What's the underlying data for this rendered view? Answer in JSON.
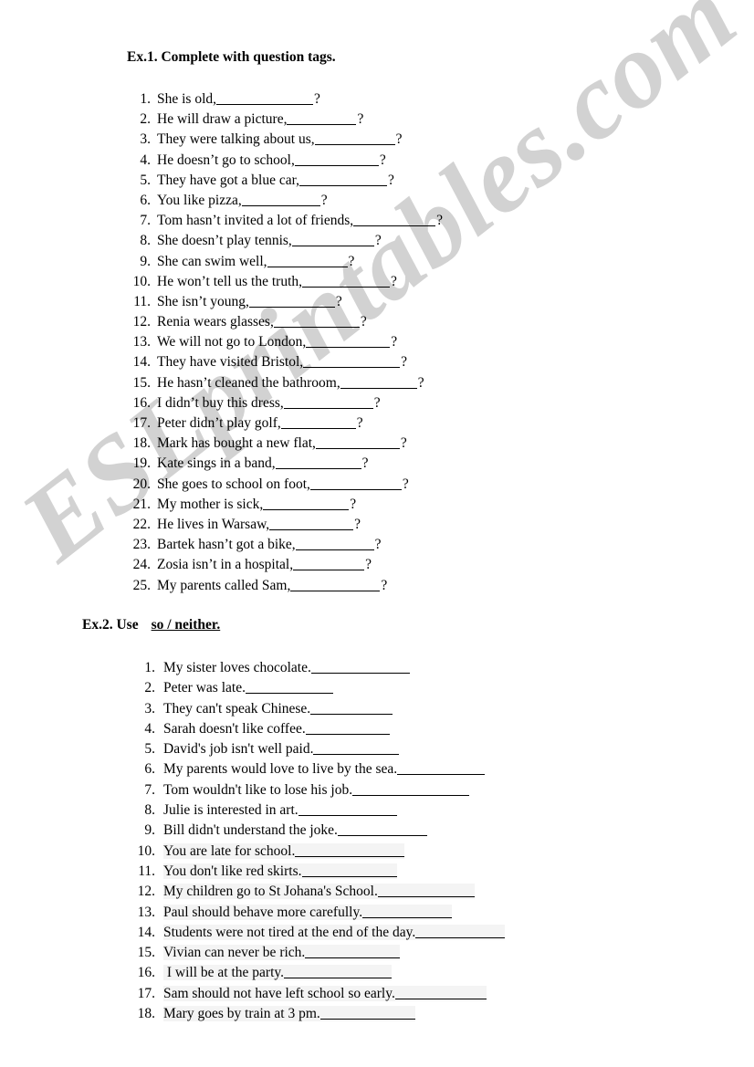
{
  "watermark": {
    "text": "ESLprintables.com",
    "color": "#d2d2d2"
  },
  "exercise1": {
    "heading": "Ex.1. Complete with question tags.",
    "items": [
      {
        "num": "1.",
        "text": "She is old,",
        "blank": 106,
        "q": "?"
      },
      {
        "num": "2.",
        "text": "He will draw a picture,",
        "blank": 76,
        "q": "?"
      },
      {
        "num": "3.",
        "text": "They were talking about us,",
        "blank": 88,
        "q": "?"
      },
      {
        "num": "4.",
        "text": "He doesn’t go to school,",
        "blank": 92,
        "q": "?"
      },
      {
        "num": "5.",
        "text": "They have got a blue car,",
        "blank": 96,
        "q": "?"
      },
      {
        "num": "6.",
        "text": "You like pizza,",
        "blank": 86,
        "q": "?"
      },
      {
        "num": "7.",
        "text": "Tom hasn’t invited a lot of friends,",
        "blank": 90,
        "q": "?"
      },
      {
        "num": "8.",
        "text": "She doesn’t play tennis,",
        "blank": 90,
        "q": "?"
      },
      {
        "num": "9.",
        "text": "She can swim well,",
        "blank": 88,
        "q": "?"
      },
      {
        "num": "10.",
        "text": "He won’t tell us the truth,",
        "blank": 96,
        "q": "?"
      },
      {
        "num": "11.",
        "text": "She isn’t young,",
        "blank": 94,
        "q": "?"
      },
      {
        "num": "12.",
        "text": "Renia wears glasses,",
        "blank": 94,
        "q": "?"
      },
      {
        "num": "13.",
        "text": "We will not go to London,",
        "blank": 92,
        "q": "?"
      },
      {
        "num": "14.",
        "text": "They have visited Bristol,",
        "blank": 106,
        "q": "?"
      },
      {
        "num": "15.",
        "text": "He hasn’t cleaned the bathroom,",
        "blank": 84,
        "q": "?"
      },
      {
        "num": "16.",
        "text": "I didn’t buy this dress,",
        "blank": 98,
        "q": "?"
      },
      {
        "num": "17.",
        "text": "Peter didn’t play golf,",
        "blank": 82,
        "q": "?"
      },
      {
        "num": "18.",
        "text": "Mark has bought a new flat,",
        "blank": 92,
        "q": "?"
      },
      {
        "num": "19.",
        "text": "Kate sings in a band,",
        "blank": 94,
        "q": "?"
      },
      {
        "num": "20.",
        "text": "She goes to school on foot,",
        "blank": 100,
        "q": "?"
      },
      {
        "num": "21.",
        "text": "My mother is sick,",
        "blank": 94,
        "q": "?"
      },
      {
        "num": "22.",
        "text": "He lives in  Warsaw,",
        "blank": 92,
        "q": "?"
      },
      {
        "num": "23.",
        "text": "Bartek hasn’t got a bike,",
        "blank": 86,
        "q": "?"
      },
      {
        "num": "24.",
        "text": "Zosia isn’t in a hospital,",
        "blank": 78,
        "q": "?"
      },
      {
        "num": "25.",
        "text": "My parents called Sam,",
        "blank": 98,
        "q": "?"
      }
    ]
  },
  "exercise2": {
    "heading_use": "Ex.2. Use",
    "heading_option": "so / neither.",
    "items": [
      {
        "num": "1.",
        "text": "My sister loves chocolate.",
        "blank": 108,
        "hl": false
      },
      {
        "num": "2.",
        "text": "Peter was late.",
        "blank": 96,
        "hl": false
      },
      {
        "num": "3.",
        "text": "They can't speak Chinese.",
        "blank": 90,
        "hl": false
      },
      {
        "num": "4.",
        "text": "Sarah doesn't like coffee.",
        "blank": 92,
        "hl": false
      },
      {
        "num": "5.",
        "text": "David's job isn't well paid.",
        "blank": 94,
        "hl": false
      },
      {
        "num": "6.",
        "text": "My parents would love to live by the sea.",
        "blank": 96,
        "hl": false
      },
      {
        "num": "7.",
        "text": "Tom wouldn't like to lose his job.",
        "blank": 128,
        "hl": false
      },
      {
        "num": "8.",
        "text": "Julie is interested in art.",
        "blank": 108,
        "hl": false
      },
      {
        "num": "9.",
        "text": "Bill didn't understand the joke.",
        "blank": 98,
        "hl": false
      },
      {
        "num": "10.",
        "text": "You are late for school.",
        "blank": 120,
        "hl": true
      },
      {
        "num": "11.",
        "text": "You don't like red skirts.",
        "blank": 104,
        "hl": true
      },
      {
        "num": "12.",
        "text": "My children go to St Johana's School.",
        "blank": 106,
        "hl": true
      },
      {
        "num": "13.",
        "text": "Paul should behave more carefully.",
        "blank": 98,
        "hl": true
      },
      {
        "num": "14.",
        "text": "Students were not tired at the end of the day.",
        "blank": 98,
        "hl": true
      },
      {
        "num": "15.",
        "text": "Vivian can never be rich.",
        "blank": 104,
        "hl": true
      },
      {
        "num": "16.",
        "text": " I will be at the party.",
        "blank": 118,
        "hl": true
      },
      {
        "num": "17.",
        "text": "Sam should not have left school so early.",
        "blank": 100,
        "hl": true
      },
      {
        "num": "18.",
        "text": "Mary goes by train at 3 pm.",
        "blank": 104,
        "hl": true
      }
    ]
  }
}
